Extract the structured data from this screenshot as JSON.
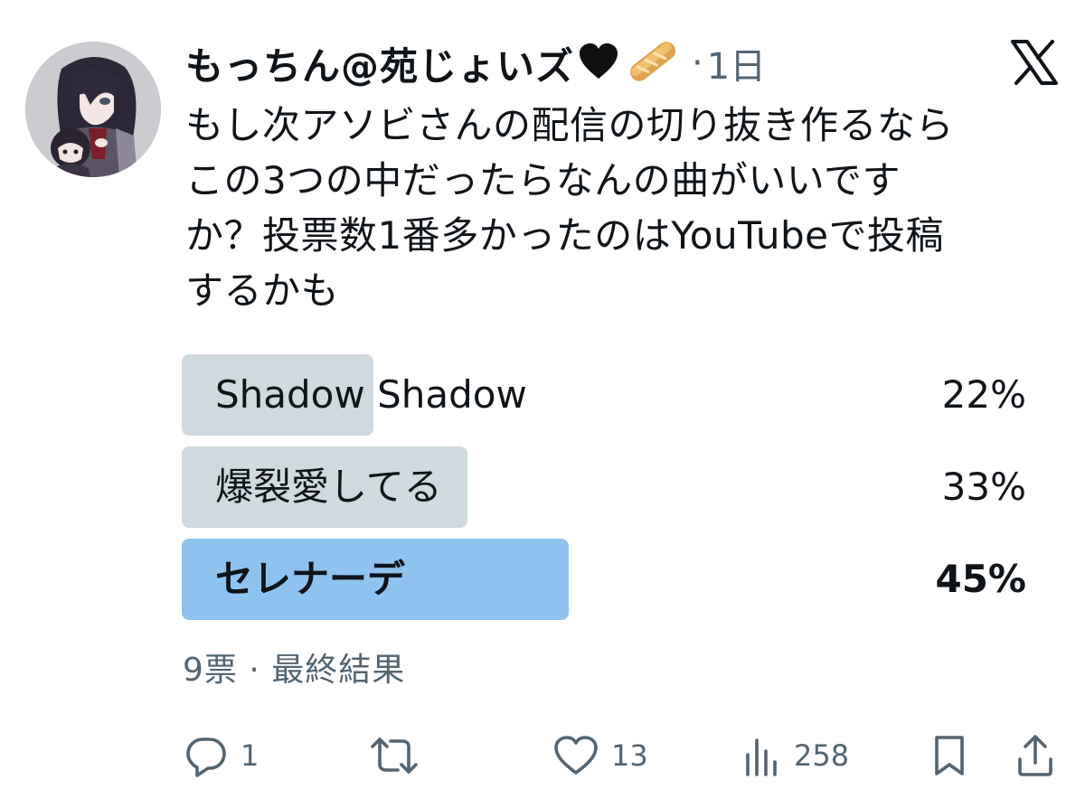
{
  "tweet": {
    "author_name": "もっちん@苑じょいズ",
    "emoji_heart": "black-heart",
    "emoji_bread": "baguette-bread",
    "separator": "·",
    "time": "1日",
    "text": "もし次アソビさんの配信の切り抜き作るなら\nこの3つの中だったらなんの曲がいいです\nか？投票数1番多かったのはYouTubeで投稿\nするかも"
  },
  "poll": {
    "options": [
      {
        "label": "Shadow Shadow",
        "percent_text": "22%",
        "percent": 22
      },
      {
        "label": "爆裂愛してる",
        "percent_text": "33%",
        "percent": 33
      },
      {
        "label": "セレナーデ",
        "percent_text": "45%",
        "percent": 45
      }
    ],
    "summary": "9票 · 最終結果"
  },
  "actions": {
    "reply_icon": "reply-icon",
    "reply_count": "1",
    "retweet_icon": "retweet-icon",
    "like_icon": "heart-icon",
    "like_count": "13",
    "views_icon": "bar-chart-icon",
    "views_count": "258",
    "bookmark_icon": "bookmark-icon",
    "share_icon": "share-icon"
  },
  "colors": {
    "text": "#0f1419",
    "secondary": "#536471",
    "bar": "#cfd9de",
    "winner_bar": "#8ec3f0"
  }
}
